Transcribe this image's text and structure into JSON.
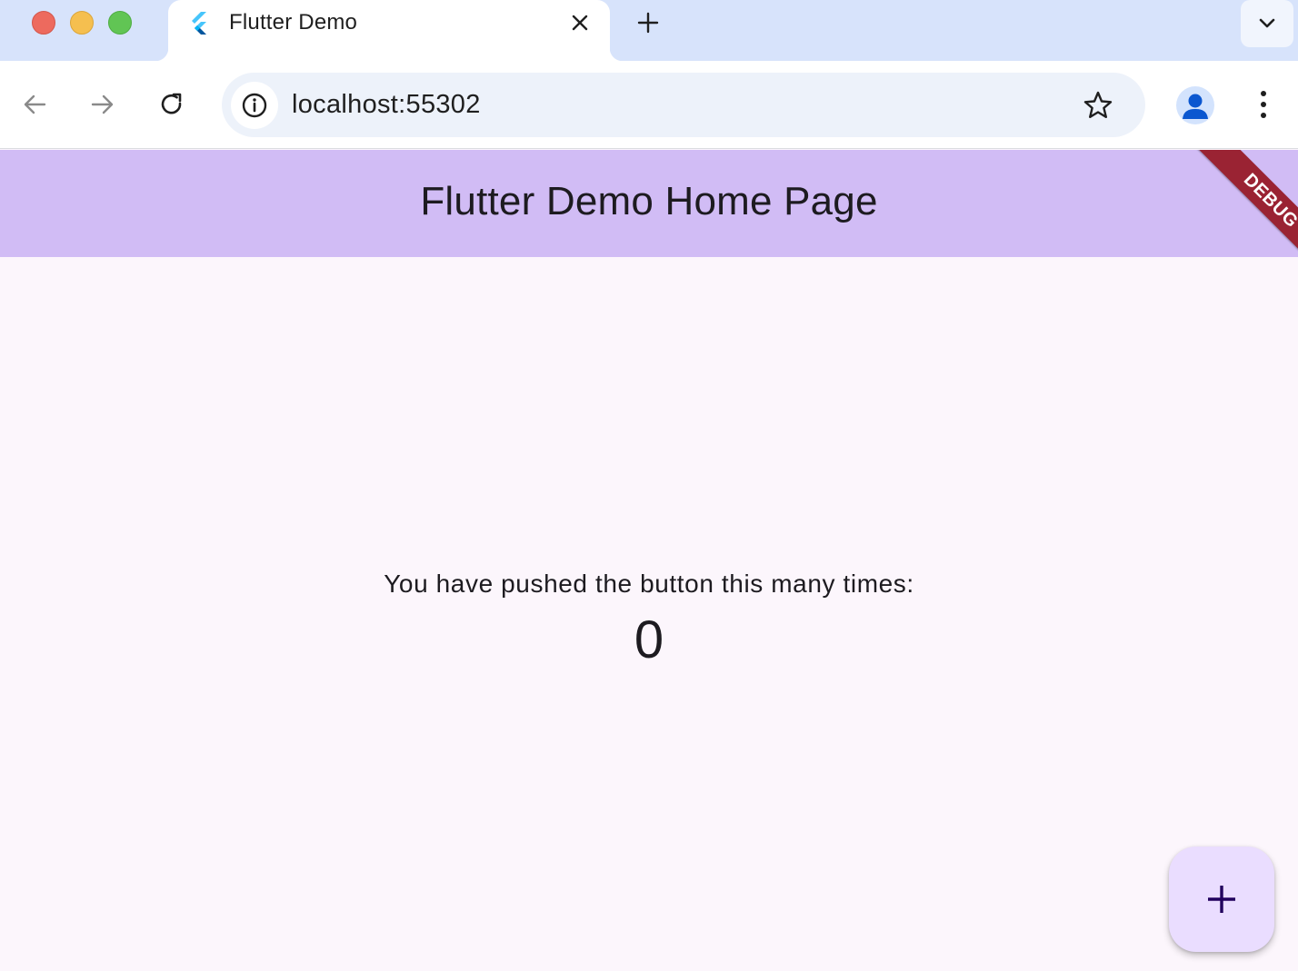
{
  "browser": {
    "tab": {
      "title": "Flutter Demo",
      "favicon": "flutter-logo-icon"
    },
    "address_bar": {
      "url": "localhost:55302"
    },
    "icons": {
      "back": "arrow-left-icon",
      "forward": "arrow-right-icon",
      "reload": "reload-icon",
      "site_info": "info-icon",
      "bookmark": "star-icon",
      "profile": "person-icon",
      "menu": "more-vertical-icon",
      "new_tab": "plus-icon",
      "tab_search": "chevron-down-icon",
      "close_tab": "close-icon"
    }
  },
  "app": {
    "appbar": {
      "title": "Flutter Demo Home Page"
    },
    "debug_banner": "DEBUG",
    "counter": {
      "label": "You have pushed the button this many times:",
      "value": "0"
    },
    "fab": {
      "icon": "plus-icon"
    },
    "colors": {
      "appbar": "#d1bcf5",
      "background": "#fcf6fc",
      "fab": "#eaddff",
      "debug_banner": "#9a2333",
      "tabstrip": "#d7e3fb"
    }
  }
}
